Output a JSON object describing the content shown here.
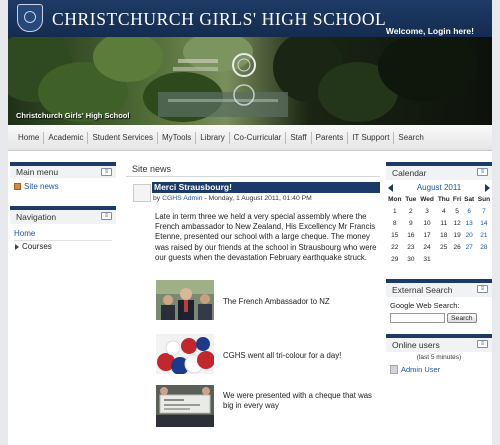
{
  "header": {
    "title": "Christchurch Girls' High School",
    "welcome": "Welcome, Login here!"
  },
  "banner": {
    "caption": "Christchurch Girls' High School"
  },
  "nav": [
    "Home",
    "Academic",
    "Student Services",
    "MyTools",
    "Library",
    "Co-Curricular",
    "Staff",
    "Parents",
    "IT Support",
    "Search"
  ],
  "main_menu": {
    "title": "Main menu",
    "items": [
      "Site news"
    ]
  },
  "navigation": {
    "title": "Navigation",
    "home": "Home",
    "courses": "Courses"
  },
  "site_news": {
    "title": "Site news",
    "post": {
      "title": "Merci Strausbourg!",
      "meta_prefix": "by",
      "author": "CGHS Admin",
      "date": "- Monday, 1 August 2011, 01:40 PM",
      "body": "Late in term three we held a very special assembly where the French ambassador to New Zealand, His Excellency Mr Francis Etenne, presented our school with a large cheque. The money was raised by our friends at the school in Strausbourg who were our guests when the devastation February earthquake struck."
    },
    "photos": [
      {
        "caption": "The French Ambassador to NZ"
      },
      {
        "caption": "CGHS went all tri-colour for a day!"
      },
      {
        "caption": "We were presented with a cheque that was big in every way"
      }
    ]
  },
  "calendar": {
    "title": "Calendar",
    "month": "August 2011",
    "weekdays": [
      "Mon",
      "Tue",
      "Wed",
      "Thu",
      "Fri",
      "Sat",
      "Sun"
    ],
    "weeks": [
      [
        "1",
        "2",
        "3",
        "4",
        "5",
        "6",
        "7"
      ],
      [
        "8",
        "9",
        "10",
        "11",
        "12",
        "13",
        "14"
      ],
      [
        "15",
        "16",
        "17",
        "18",
        "19",
        "20",
        "21"
      ],
      [
        "22",
        "23",
        "24",
        "25",
        "26",
        "27",
        "28"
      ],
      [
        "29",
        "30",
        "31",
        "",
        "",
        "",
        ""
      ]
    ]
  },
  "external_search": {
    "title": "External Search",
    "label": "Google Web Search:",
    "button": "Search"
  },
  "online_users": {
    "title": "Online users",
    "note": "(last 5 minutes)",
    "users": [
      "Admin User"
    ]
  },
  "colors": {
    "brand_navy": "#1b3a68",
    "link": "#1d55a5"
  },
  "icons": [
    "crest-logo",
    "news-icon",
    "block-control-icon",
    "calendar-prev-arrow",
    "calendar-next-arrow",
    "user-icon"
  ]
}
